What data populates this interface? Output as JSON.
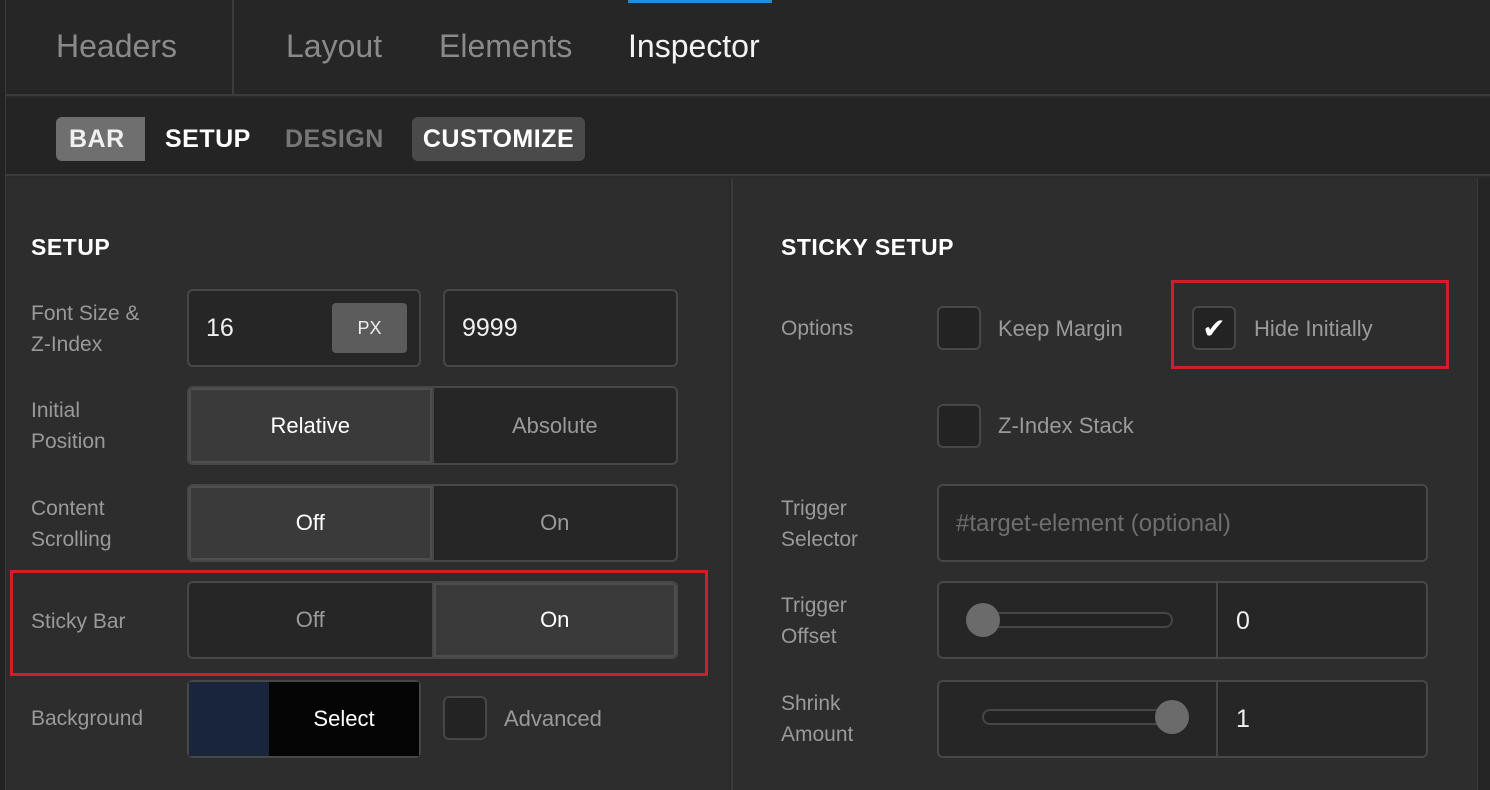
{
  "top_tabs": {
    "headers": "Headers",
    "layout": "Layout",
    "elements": "Elements",
    "inspector": "Inspector",
    "active": "Inspector",
    "accent_color": "#1e8fd8"
  },
  "breadcrumb": {
    "bar": "BAR",
    "setup": "SETUP",
    "design": "DESIGN",
    "customize": "CUSTOMIZE"
  },
  "setup": {
    "title": "SETUP",
    "font_size": {
      "label_line1": "Font Size &",
      "label_line2": "Z-Index",
      "value": "16",
      "unit": "PX",
      "z_index": "9999"
    },
    "initial_position": {
      "label_line1": "Initial",
      "label_line2": "Position",
      "options": [
        "Relative",
        "Absolute"
      ],
      "selected": "Relative"
    },
    "content_scrolling": {
      "label_line1": "Content",
      "label_line2": "Scrolling",
      "options": [
        "Off",
        "On"
      ],
      "selected": "Off"
    },
    "sticky_bar": {
      "label": "Sticky Bar",
      "options": [
        "Off",
        "On"
      ],
      "selected": "On"
    },
    "background": {
      "label": "Background",
      "swatch_color": "#18253a",
      "select_label": "Select",
      "advanced_label": "Advanced",
      "advanced_checked": false
    }
  },
  "sticky_setup": {
    "title": "STICKY SETUP",
    "options_label": "Options",
    "keep_margin": {
      "label": "Keep Margin",
      "checked": false
    },
    "hide_initially": {
      "label": "Hide Initially",
      "checked": true,
      "check_glyph": "✔"
    },
    "z_index_stack": {
      "label": "Z-Index Stack",
      "checked": false
    },
    "trigger_selector": {
      "label_line1": "Trigger",
      "label_line2": "Selector",
      "placeholder": "#target-element (optional)"
    },
    "trigger_offset": {
      "label_line1": "Trigger",
      "label_line2": "Offset",
      "value": "0",
      "slider_level": 0
    },
    "shrink_amount": {
      "label_line1": "Shrink",
      "label_line2": "Amount",
      "value": "1",
      "slider_level": 1
    }
  },
  "highlight_color": "#d21e26"
}
